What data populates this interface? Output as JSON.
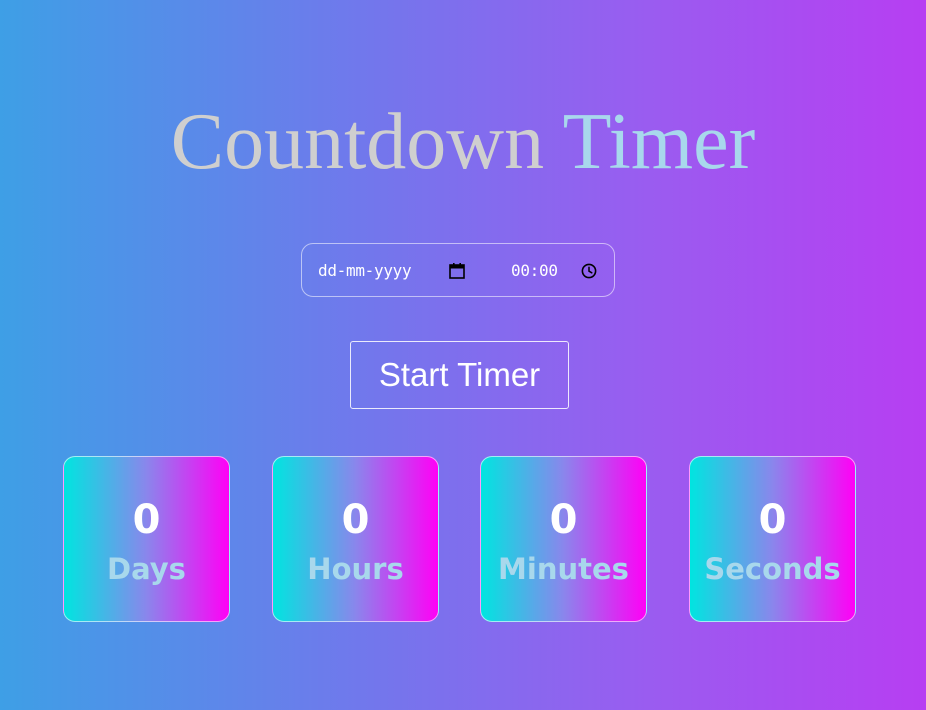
{
  "title": {
    "word1": "Countdown",
    "word2": "Timer"
  },
  "datetime_input": {
    "date_placeholder": "dd-mm-yyyy",
    "time_value": "00:00",
    "date_icon": "calendar-icon",
    "time_icon": "clock-icon"
  },
  "start_button": {
    "label": "Start Timer"
  },
  "countdown": {
    "days": {
      "value": "0",
      "label": "Days"
    },
    "hours": {
      "value": "0",
      "label": "Hours"
    },
    "minutes": {
      "value": "0",
      "label": "Minutes"
    },
    "seconds": {
      "value": "0",
      "label": "Seconds"
    }
  },
  "colors": {
    "background_start": "#3e9fe6",
    "background_end": "#b73ef2",
    "card_gradient_start": "#00e5e0",
    "card_gradient_end": "#ff00f6",
    "label_color": "#a8d8ec",
    "title_color": "#cfcfcf"
  }
}
